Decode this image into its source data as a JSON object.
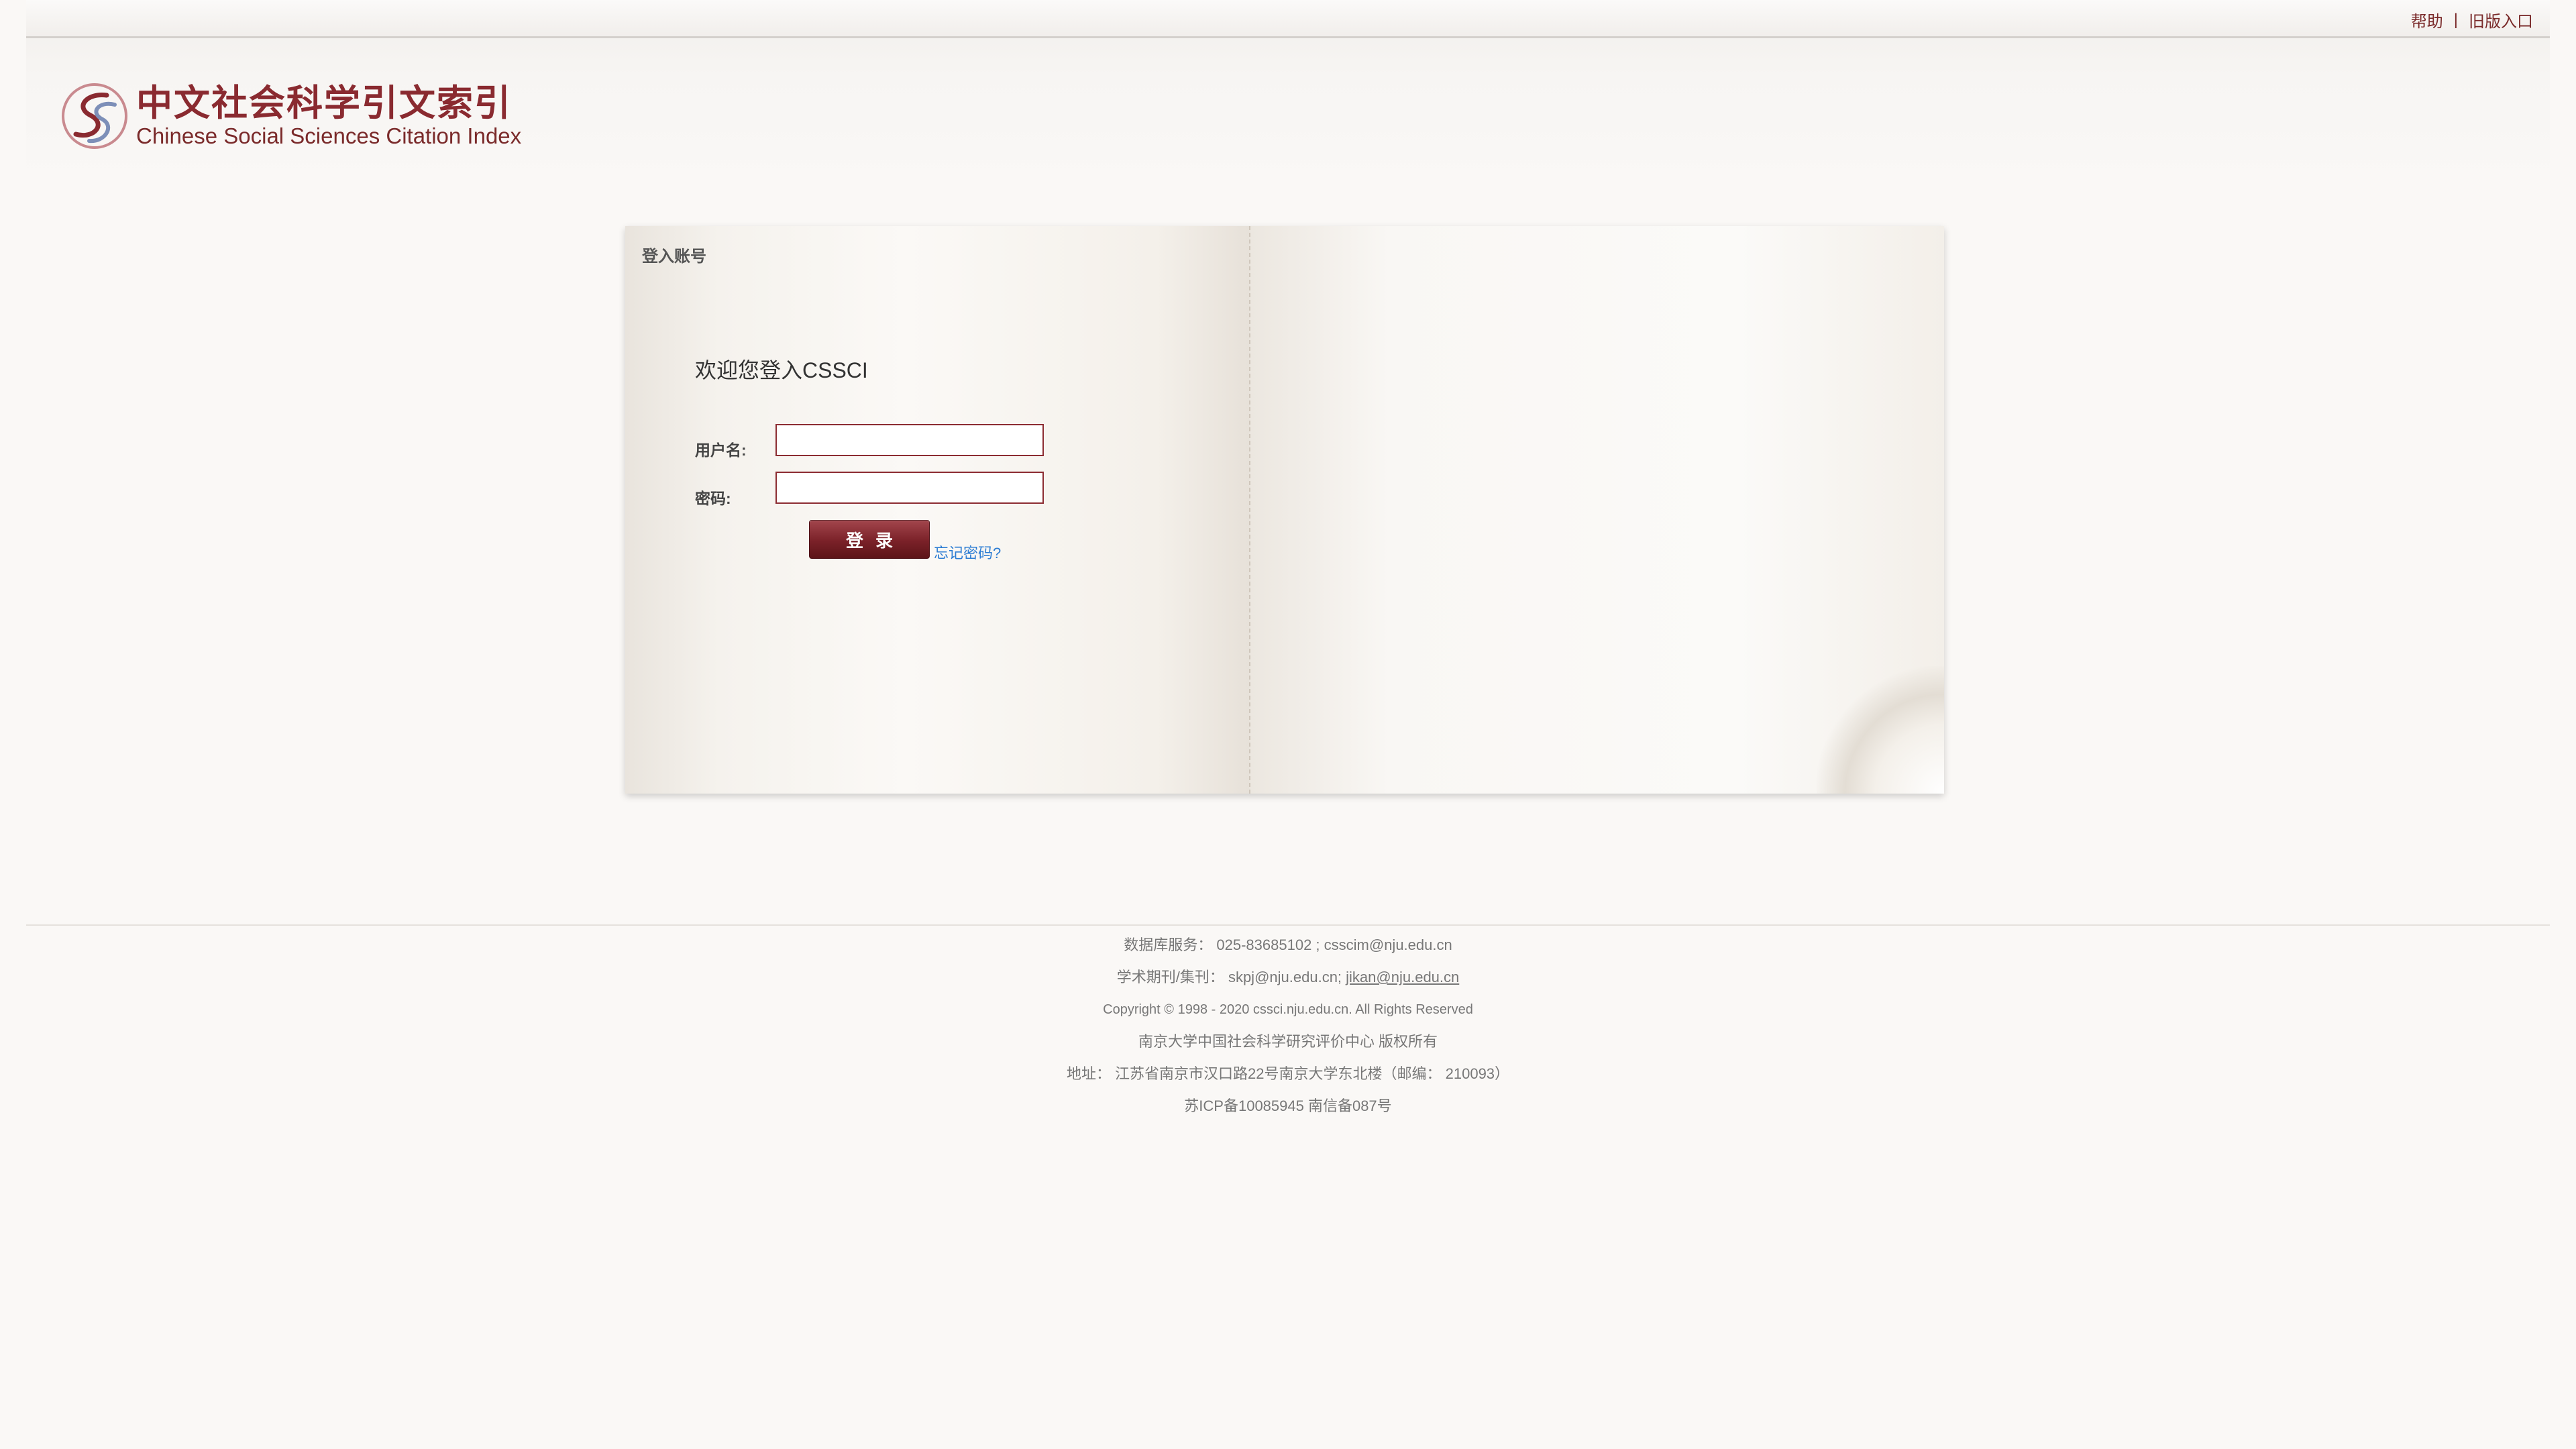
{
  "topbar": {
    "help": "帮助",
    "separator": "|",
    "old_version": "旧版入口"
  },
  "logo": {
    "cn": "中文社会科学引文索引",
    "en": "Chinese Social Sciences Citation Index"
  },
  "login_panel": {
    "title": "登入账号",
    "welcome": "欢迎您登入CSSCI",
    "username_label": "用户名:",
    "username_value": "",
    "password_label": "密码:",
    "password_value": "",
    "login_button": "登录",
    "forgot_password": "忘记密码?"
  },
  "footer": {
    "db_service": "数据库服务：  025-83685102 ; csscim@nju.edu.cn",
    "journal_label": "学术期刊/集刊：  skpj@nju.edu.cn; ",
    "journal_link": "jikan@nju.edu.cn",
    "copyright": "Copyright © 1998 - 2020 cssci.nju.edu.cn. All Rights Reserved",
    "owner": "南京大学中国社会科学研究评价中心 版权所有",
    "address": "地址：  江苏省南京市汉口路22号南京大学东北楼（邮编：  210093）",
    "icp": "苏ICP备10085945    南信备087号"
  },
  "colors": {
    "brand": "#8a2a30",
    "link": "#2b7cd3",
    "background": "#faf8f6"
  }
}
